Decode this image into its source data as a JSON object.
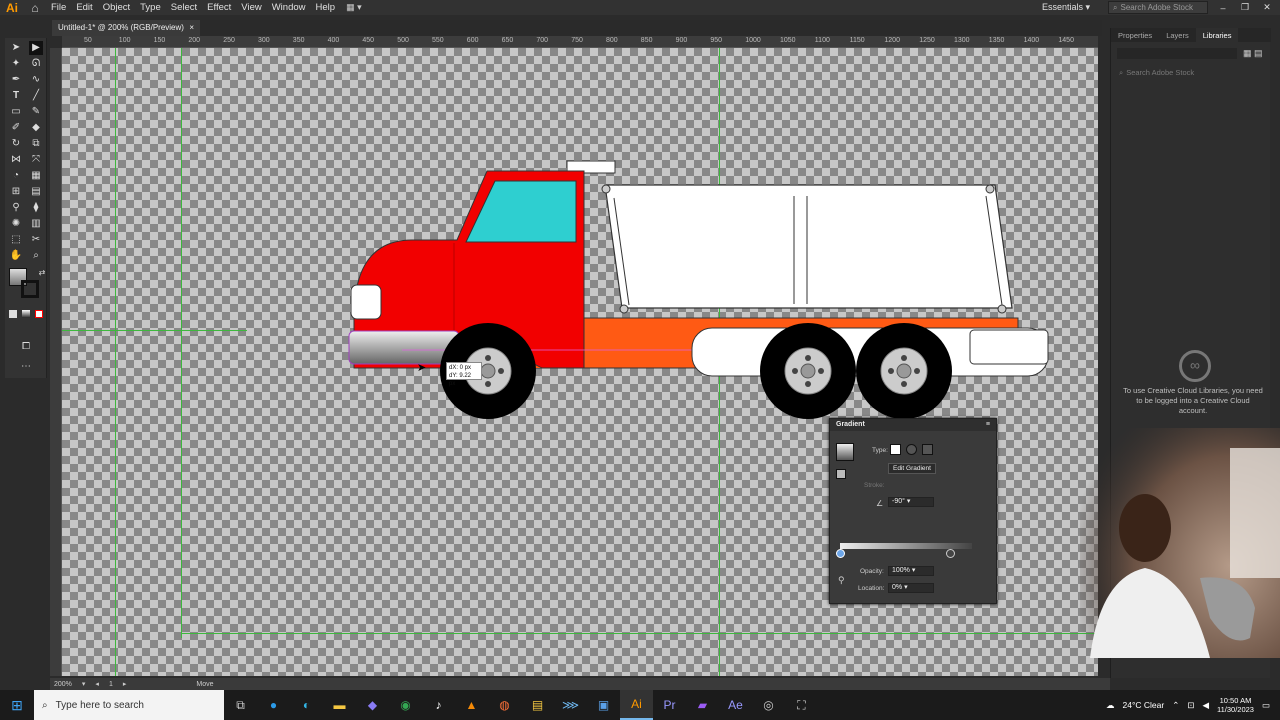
{
  "app": {
    "logo": "Ai",
    "home_icon": "home-icon"
  },
  "menu": [
    "File",
    "Edit",
    "Object",
    "Type",
    "Select",
    "Effect",
    "View",
    "Window",
    "Help"
  ],
  "workspace": "Essentials",
  "search_stock_placeholder": "Search Adobe Stock",
  "document_tab": {
    "title": "Untitled-1* @ 200% (RGB/Preview)",
    "close": "×"
  },
  "ruler_marks": [
    "50",
    "100",
    "150",
    "200",
    "250",
    "300",
    "350",
    "400",
    "450",
    "500",
    "550",
    "600",
    "650",
    "700",
    "750",
    "800",
    "850",
    "900",
    "950",
    "1000",
    "1050",
    "1100",
    "1150",
    "1200",
    "1250",
    "1300",
    "1350",
    "1400",
    "1450"
  ],
  "tooltip": {
    "dx": "dX: 0 px",
    "dy": "dY: 9.22 px"
  },
  "right_panel": {
    "tabs": [
      "Properties",
      "Layers",
      "Libraries"
    ],
    "active_tab": "Libraries",
    "search_placeholder": "Search Adobe Stock",
    "message": "To use Creative Cloud Libraries, you need to be logged into a Creative Cloud account."
  },
  "gradient_panel": {
    "title": "Gradient",
    "type_label": "Type:",
    "edit_button": "Edit Gradient",
    "stroke_label": "Stroke:",
    "angle": "-90°",
    "opacity_label": "Opacity:",
    "opacity": "100%",
    "location_label": "Location:",
    "location": "0%"
  },
  "status": {
    "zoom": "200%",
    "artboard": "1",
    "tool": "Move"
  },
  "taskbar": {
    "search_placeholder": "Type here to search",
    "weather": "24°C  Clear",
    "time": "10:50 AM",
    "date": "11/30/2023"
  },
  "colors": {
    "cab": "#f20000",
    "chassis": "#ff5a14",
    "windshield": "#2ecfd0",
    "guide": "#3db83d",
    "accent": "#ff9a00"
  }
}
